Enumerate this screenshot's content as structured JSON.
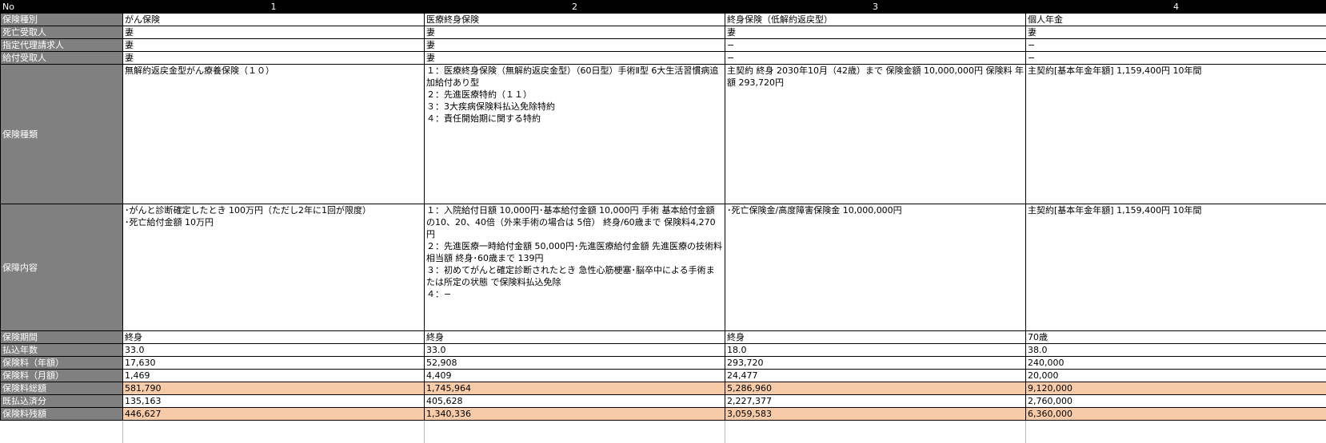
{
  "header": {
    "label": "No",
    "numbers": [
      "1",
      "2",
      "3",
      "4"
    ]
  },
  "rows": {
    "kind": {
      "label": "保険種別",
      "values": [
        "がん保険",
        "医療終身保険",
        "終身保険（低解約返戻型）",
        "個人年金"
      ]
    },
    "death_beneficiary": {
      "label": "死亡受取人",
      "values": [
        "妻",
        "妻",
        "妻",
        "妻"
      ]
    },
    "designated_agent": {
      "label": "指定代理請求人",
      "values": [
        "妻",
        "妻",
        "−",
        "−"
      ]
    },
    "benefit_recipient": {
      "label": "給付受取人",
      "values": [
        "妻",
        "妻",
        "−",
        "−"
      ]
    },
    "insurance_type": {
      "label": "保険種類",
      "values": [
        [
          "無解約返戻金型がん療養保険（１０）"
        ],
        [
          "１：医療終身保険（無解約返戻金型）（60日型）手術Ⅱ型 6大生活習慣病追加給付あり型",
          "２：先進医療特約（１１）",
          "３：3大疾病保険料払込免除特約",
          "４：責任開始期に関する特約"
        ],
        [
          "主契約 終身 2030年10月（42歳）まで 保険金額 10,000,000円 保険料 年額 293,720円"
        ],
        [
          "主契約[基本年金年額] 1,159,400円 10年間"
        ]
      ]
    },
    "coverage": {
      "label": "保障内容",
      "values": [
        [
          "･がんと診断確定したとき 100万円（ただし2年に1回が限度）",
          "･死亡給付金額 10万円"
        ],
        [
          "１：入院給付日額 10,000円･基本給付金額 10,000円 手術 基本給付金額の10、20、40倍（外来手術の場合は 5倍） 終身/60歳まで 保険料4,270円",
          "２：先進医療一時給付金額 50,000円･先進医療給付金額 先進医療の技術料相当額 終身･60歳まで 139円",
          "３：初めてがんと確定診断されたとき 急性心筋梗塞･脳卒中による手術または所定の状態 で保険料払込免除",
          "４：−"
        ],
        [
          "･死亡保険金/高度障害保険金 10,000,000円"
        ],
        [
          "主契約[基本年金年額] 1,159,400円 10年間"
        ]
      ]
    },
    "period": {
      "label": "保険期間",
      "values": [
        "終身",
        "終身",
        "終身",
        "70歳"
      ]
    },
    "pay_years": {
      "label": "払込年数",
      "values": [
        "33.0",
        "33.0",
        "18.0",
        "38.0"
      ]
    },
    "premium_year": {
      "label": "保険料（年額）",
      "values": [
        "17,630",
        "52,908",
        "293,720",
        "240,000"
      ]
    },
    "premium_month": {
      "label": "保険料（月額）",
      "values": [
        "1,469",
        "4,409",
        "24,477",
        "20,000"
      ]
    },
    "premium_total": {
      "label": "保険料総額",
      "values": [
        "581,790",
        "1,745,964",
        "5,286,960",
        "9,120,000"
      ]
    },
    "paid": {
      "label": "既払込済分",
      "values": [
        "135,163",
        "405,628",
        "2,227,377",
        "2,760,000"
      ]
    },
    "remaining": {
      "label": "保険料残額",
      "values": [
        "446,627",
        "1,340,336",
        "3,059,583",
        "6,360,000"
      ]
    }
  },
  "colors": {
    "header_bg": "#000000",
    "label_bg": "#808080",
    "highlight_bg": "#f8cba8"
  }
}
